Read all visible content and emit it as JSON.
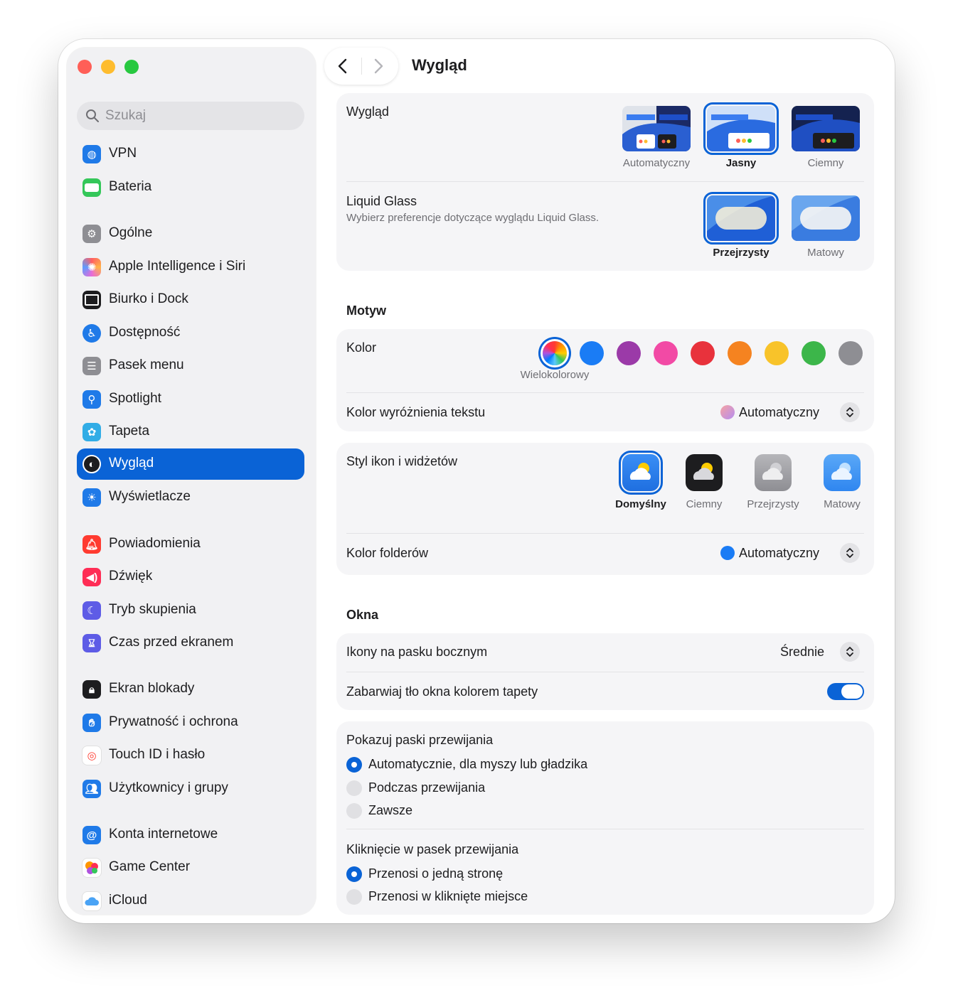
{
  "sidebar": {
    "search_placeholder": "Szukaj",
    "items": [
      {
        "label": "VPN",
        "icon": "globe-icon",
        "color": "#1f7ae8"
      },
      {
        "label": "Bateria",
        "icon": "battery-icon",
        "color": "#34c759"
      },
      {
        "label": "Ogólne",
        "icon": "gear-icon",
        "color": "#8e8e93"
      },
      {
        "label": "Apple Intelligence i Siri",
        "icon": "siri-icon",
        "color": "#e86ad8"
      },
      {
        "label": "Biurko i Dock",
        "icon": "dock-icon",
        "color": "#1d1d1f"
      },
      {
        "label": "Dostępność",
        "icon": "accessibility-icon",
        "color": "#1f7ae8"
      },
      {
        "label": "Pasek menu",
        "icon": "menu-bar-icon",
        "color": "#8e8e93"
      },
      {
        "label": "Spotlight",
        "icon": "magnifier-icon",
        "color": "#1f7ae8"
      },
      {
        "label": "Tapeta",
        "icon": "flower-icon",
        "color": "#32ade6"
      },
      {
        "label": "Wygląd",
        "icon": "appearance-icon",
        "color": "#1d1d1f",
        "selected": true
      },
      {
        "label": "Wyświetlacze",
        "icon": "sun-icon",
        "color": "#1f7ae8"
      },
      {
        "label": "Powiadomienia",
        "icon": "bell-icon",
        "color": "#ff3b30"
      },
      {
        "label": "Dźwięk",
        "icon": "speaker-icon",
        "color": "#ff2d55"
      },
      {
        "label": "Tryb skupienia",
        "icon": "moon-icon",
        "color": "#5e5ce6"
      },
      {
        "label": "Czas przed ekranem",
        "icon": "hourglass-icon",
        "color": "#5e5ce6"
      },
      {
        "label": "Ekran blokady",
        "icon": "lock-icon",
        "color": "#1d1d1f"
      },
      {
        "label": "Prywatność i ochrona",
        "icon": "hand-icon",
        "color": "#1f7ae8"
      },
      {
        "label": "Touch ID i hasło",
        "icon": "fingerprint-icon",
        "color": "#ffffff"
      },
      {
        "label": "Użytkownicy i grupy",
        "icon": "users-icon",
        "color": "#1f7ae8"
      },
      {
        "label": "Konta internetowe",
        "icon": "at-icon",
        "color": "#1f7ae8"
      },
      {
        "label": "Game Center",
        "icon": "game-center-icon",
        "color": "#ff9500"
      },
      {
        "label": "iCloud",
        "icon": "cloud-icon",
        "color": "#ffffff"
      }
    ]
  },
  "header": {
    "title": "Wygląd"
  },
  "appearance": {
    "label": "Wygląd",
    "options": [
      {
        "label": "Automatyczny",
        "selected": false
      },
      {
        "label": "Jasny",
        "selected": true
      },
      {
        "label": "Ciemny",
        "selected": false
      }
    ]
  },
  "liquid_glass": {
    "label": "Liquid Glass",
    "description": "Wybierz preferencje dotyczące wyglądu Liquid Glass.",
    "options": [
      {
        "label": "Przejrzysty",
        "selected": true
      },
      {
        "label": "Matowy",
        "selected": false
      }
    ]
  },
  "theme": {
    "title": "Motyw",
    "color_label": "Kolor",
    "selected_color_caption": "Wielokolorowy",
    "swatches": [
      "multicolor",
      "#1a7cf5",
      "#9b3aa8",
      "#f24aa5",
      "#e8323c",
      "#f58320",
      "#f8c32a",
      "#3cb64a",
      "#8e8e93"
    ],
    "highlight_label": "Kolor wyróżnienia tekstu",
    "highlight_value": "Automatyczny"
  },
  "icons": {
    "label": "Styl ikon i widżetów",
    "options": [
      {
        "label": "Domyślny",
        "selected": true
      },
      {
        "label": "Ciemny",
        "selected": false
      },
      {
        "label": "Przejrzysty",
        "selected": false
      },
      {
        "label": "Matowy",
        "selected": false
      }
    ],
    "folder_label": "Kolor folderów",
    "folder_value": "Automatyczny"
  },
  "windows": {
    "title": "Okna",
    "sidebar_icons_label": "Ikony na pasku bocznym",
    "sidebar_icons_value": "Średnie",
    "tint_label": "Zabarwiaj tło okna kolorem tapety",
    "tint_on": true
  },
  "scrollbars": {
    "show_label": "Pokazuj paski przewijania",
    "show_options": [
      {
        "label": "Automatycznie, dla myszy lub gładzika",
        "selected": true
      },
      {
        "label": "Podczas przewijania",
        "selected": false
      },
      {
        "label": "Zawsze",
        "selected": false
      }
    ],
    "click_label": "Kliknięcie w pasek przewijania",
    "click_options": [
      {
        "label": "Przenosi o jedną stronę",
        "selected": true
      },
      {
        "label": "Przenosi w kliknięte miejsce",
        "selected": false
      }
    ]
  }
}
